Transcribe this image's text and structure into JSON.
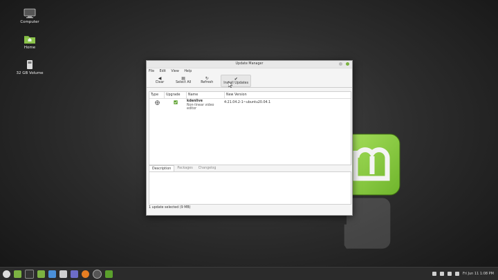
{
  "desktop": {
    "icons": [
      {
        "label": "Computer"
      },
      {
        "label": "Home"
      },
      {
        "label": "32 GB Volume"
      }
    ]
  },
  "window": {
    "title": "Update Manager",
    "menu": [
      "File",
      "Edit",
      "View",
      "Help"
    ],
    "toolbar": {
      "clear": "Clear",
      "select_all": "Select All",
      "refresh": "Refresh",
      "install": "Install Updates"
    },
    "columns": {
      "type": "Type",
      "upgrade": "Upgrade",
      "name": "Name",
      "version": "New Version"
    },
    "rows": [
      {
        "name": "kdenlive",
        "description": "Non-linear video editor",
        "version": "4:21.04.2-1~ubuntu20.04.1",
        "checked": true
      }
    ],
    "tabs": [
      "Description",
      "Packages",
      "Changelog"
    ],
    "status": "1 update selected (9 MB)"
  },
  "taskbar": {
    "clock": "Fri Jun 11  1:08 PM"
  },
  "colors": {
    "mint_green": "#87cf3e",
    "check_green": "#5aa02c"
  }
}
